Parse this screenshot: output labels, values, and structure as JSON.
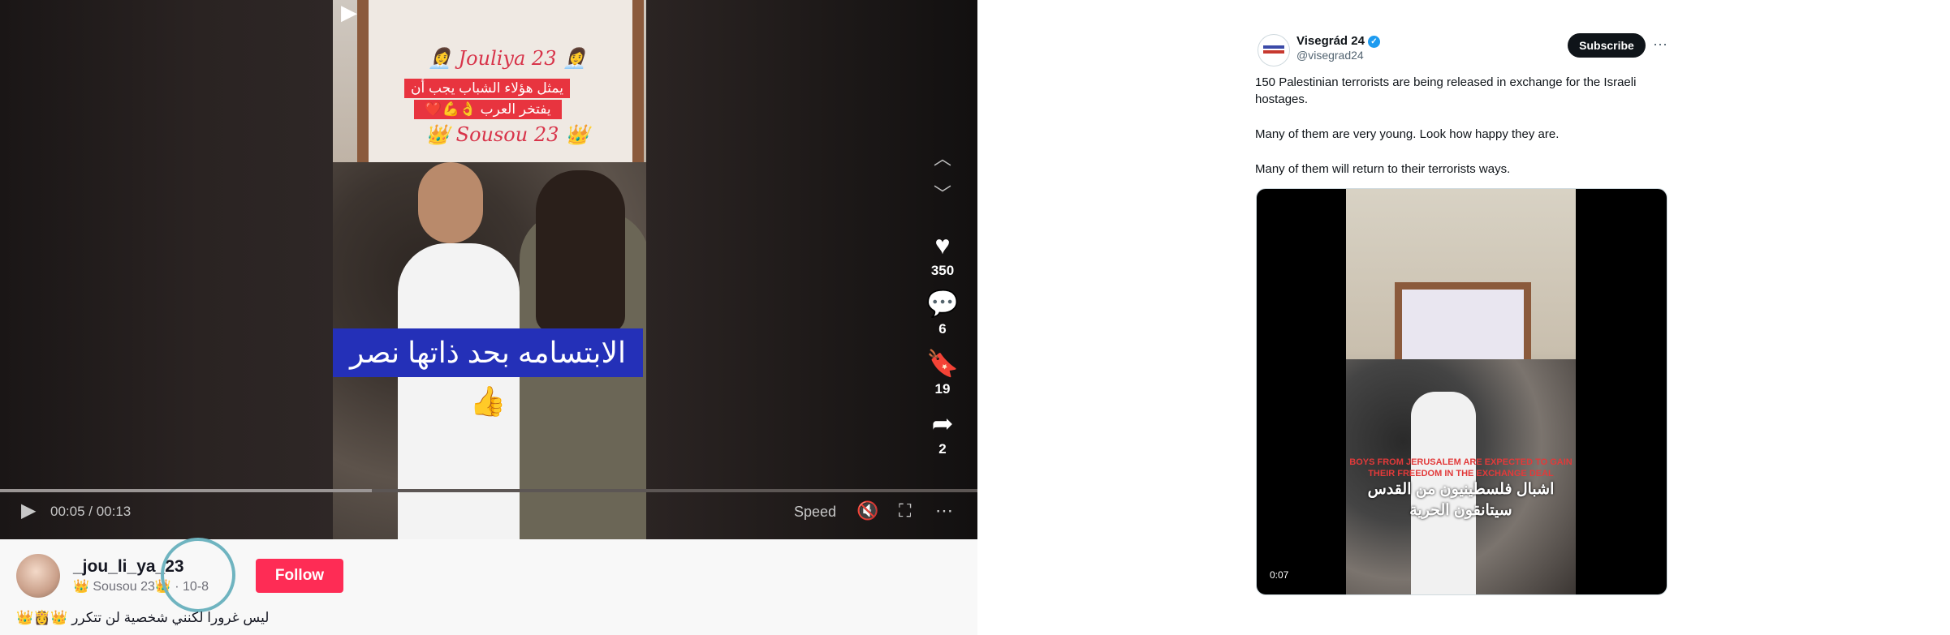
{
  "left_player": {
    "overlay": {
      "top_name": "👩‍💼 Jouliya 23 👩‍💼",
      "line1": "يمثل هؤلاء الشباب يجب أن",
      "line2": "يفتخر العرب 👌💪❤️",
      "bottom_name": "👑 Sousou 23 👑",
      "banner": "الابتسامه بحد ذاتها نصر👍"
    },
    "rail": {
      "likes": "350",
      "comments": "6",
      "saves": "19",
      "shares": "2"
    },
    "controls": {
      "time": "00:05 / 00:13",
      "speed": "Speed",
      "progress_fraction": 0.38
    },
    "author": {
      "username": "_jou_li_ya_23",
      "subline": "👑 Sousou 23👑 · 10-8",
      "follow_label": "Follow"
    },
    "caption": "ليس غرورا لكنني شخصية لن تتكرر 👑👸👑"
  },
  "tweet": {
    "name": "Visegrád 24",
    "handle": "@visegrad24",
    "subscribe_label": "Subscribe",
    "paragraphs": [
      "150 Palestinian terrorists are being released in exchange for the Israeli hostages.",
      "Many of them are very young. Look how happy they are.",
      "Many of them will return to their terrorists ways."
    ],
    "video": {
      "red_caption": "BOYS FROM JERUSALEM ARE EXPECTED TO GAIN THEIR FREEDOM IN THE EXCHANGE DEAL",
      "arabic_caption_1": "اشبال فلسطينيون من القدس",
      "arabic_caption_2": "سيتانقون الحرية",
      "duration": "0:07"
    }
  },
  "colors": {
    "follow": "#fe2c55",
    "verified": "#1d9bf0",
    "banner": "#2430b8"
  }
}
